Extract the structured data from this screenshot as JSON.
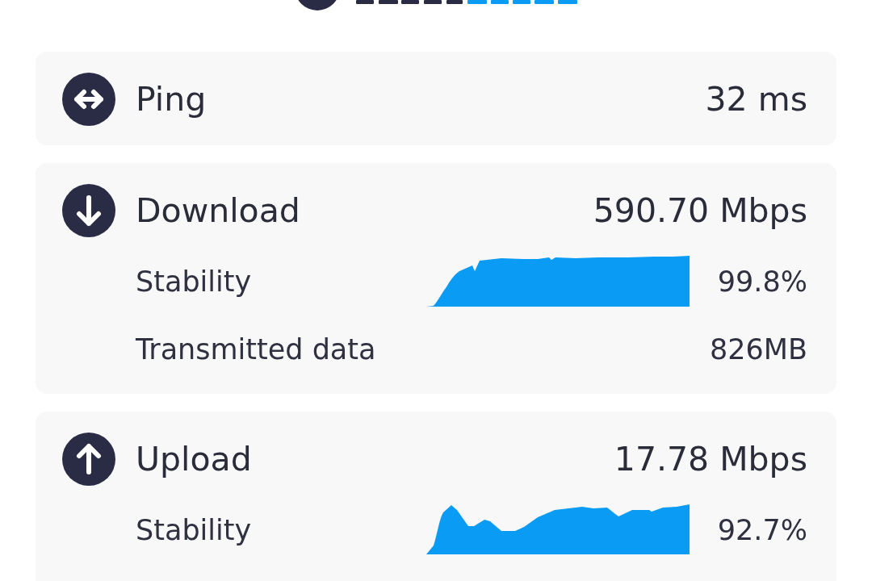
{
  "metrics": [
    {
      "kind": "ping",
      "label": "Ping",
      "value": "32 ms"
    },
    {
      "kind": "download",
      "label": "Download",
      "value": "590.70 Mbps",
      "details": [
        {
          "kind": "stability",
          "label": "Stability",
          "value": "99.8%"
        },
        {
          "kind": "data",
          "label": "Transmitted data",
          "value": "826MB"
        }
      ]
    },
    {
      "kind": "upload",
      "label": "Upload",
      "value": "17.78 Mbps",
      "details": [
        {
          "kind": "stability",
          "label": "Stability",
          "value": "92.7%"
        }
      ]
    }
  ]
}
